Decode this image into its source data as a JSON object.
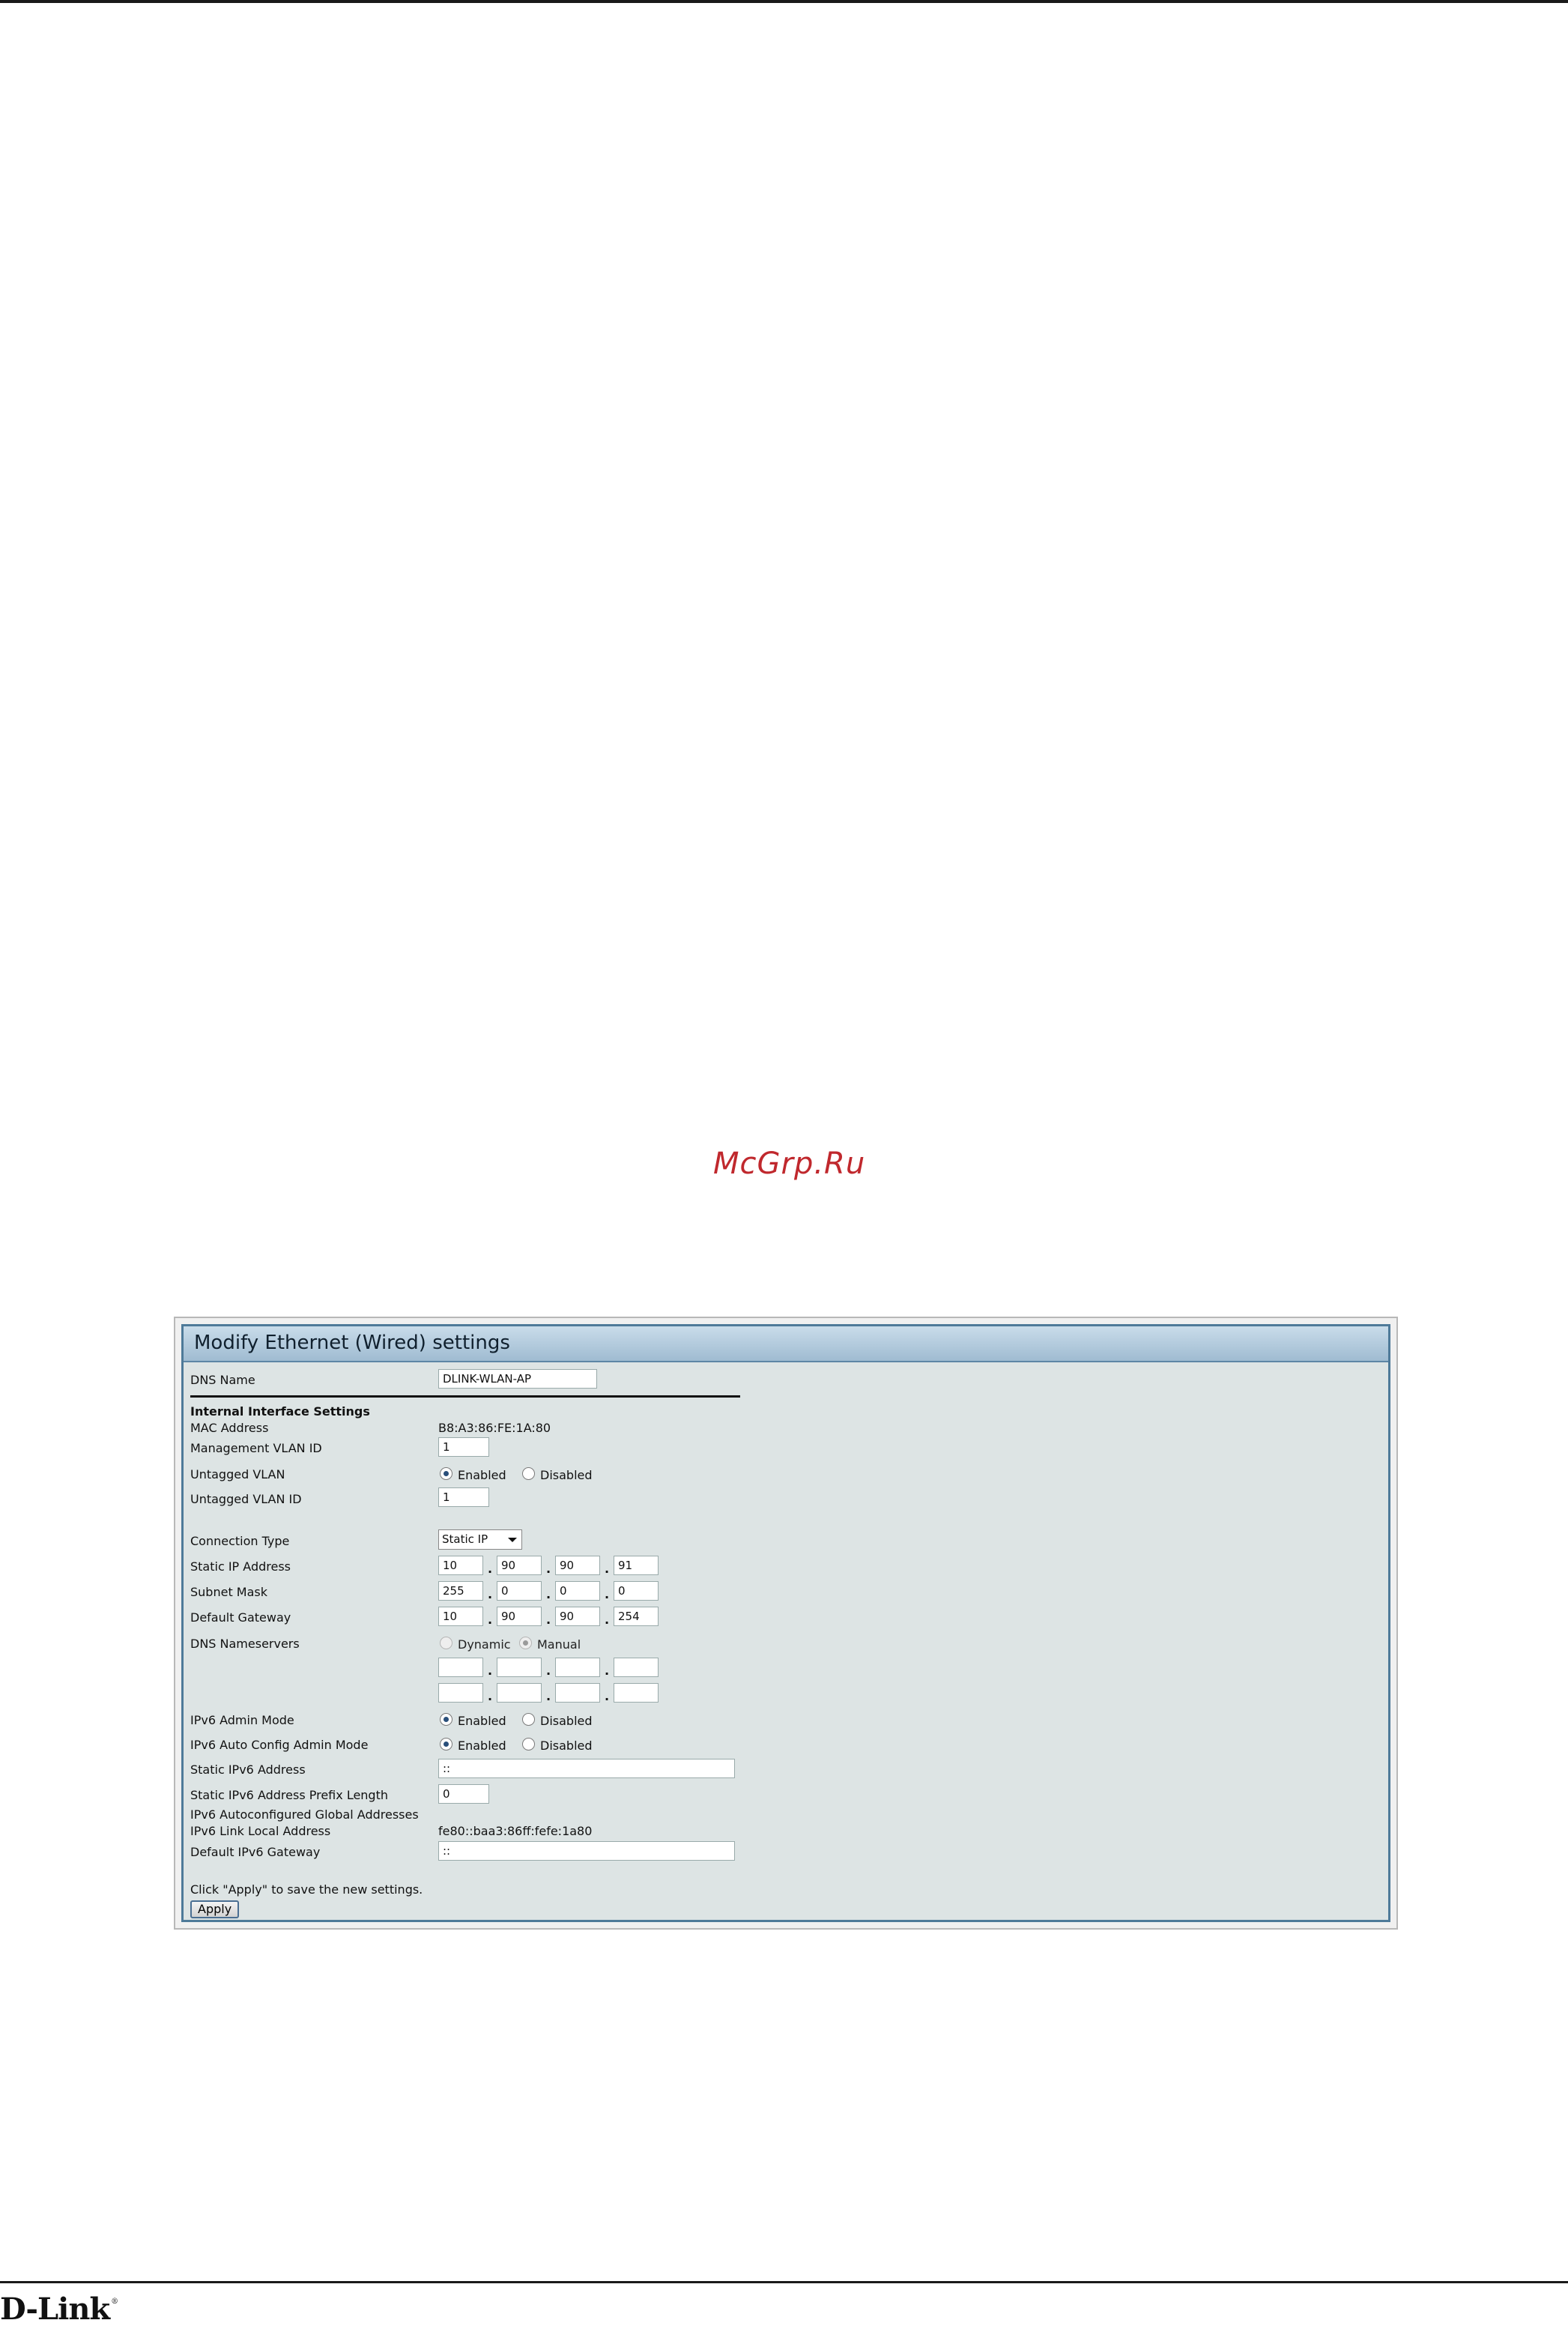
{
  "watermark": "McGrp.Ru",
  "logo": {
    "text": "D-Link",
    "mark": "®"
  },
  "panel": {
    "title": "Modify Ethernet (Wired) settings",
    "dns_name": {
      "label": "DNS Name",
      "value": "DLINK-WLAN-AP"
    },
    "section_title": "Internal Interface Settings",
    "mac": {
      "label": "MAC Address",
      "value": "B8:A3:86:FE:1A:80"
    },
    "mgmt_vlan": {
      "label": "Management VLAN ID",
      "value": "1"
    },
    "untagged_vlan": {
      "label": "Untagged VLAN",
      "enabled_label": "Enabled",
      "disabled_label": "Disabled",
      "selected": "Enabled"
    },
    "untagged_vlan_id": {
      "label": "Untagged VLAN ID",
      "value": "1"
    },
    "connection_type": {
      "label": "Connection Type",
      "value": "Static IP"
    },
    "static_ip": {
      "label": "Static IP Address",
      "octets": [
        "10",
        "90",
        "90",
        "91"
      ]
    },
    "subnet": {
      "label": "Subnet Mask",
      "octets": [
        "255",
        "0",
        "0",
        "0"
      ]
    },
    "gateway": {
      "label": "Default Gateway",
      "octets": [
        "10",
        "90",
        "90",
        "254"
      ]
    },
    "dns_servers": {
      "label": "DNS Nameservers",
      "dynamic_label": "Dynamic",
      "manual_label": "Manual",
      "selected": "Manual",
      "server1": [
        "",
        "",
        "",
        ""
      ],
      "server2": [
        "",
        "",
        "",
        ""
      ]
    },
    "ipv6_admin": {
      "label": "IPv6 Admin Mode",
      "enabled_label": "Enabled",
      "disabled_label": "Disabled",
      "selected": "Enabled"
    },
    "ipv6_auto": {
      "label": "IPv6 Auto Config Admin Mode",
      "enabled_label": "Enabled",
      "disabled_label": "Disabled",
      "selected": "Enabled"
    },
    "static_ipv6": {
      "label": "Static IPv6 Address",
      "value": "::"
    },
    "static_ipv6_prefix": {
      "label": "Static IPv6 Address Prefix Length",
      "value": "0"
    },
    "ipv6_autoconf_global": {
      "label": "IPv6 Autoconfigured Global Addresses"
    },
    "ipv6_link_local": {
      "label": "IPv6 Link Local Address",
      "value": "fe80::baa3:86ff:fefe:1a80"
    },
    "default_ipv6_gw": {
      "label": "Default IPv6 Gateway",
      "value": "::"
    },
    "hint": "Click \"Apply\" to save the new settings.",
    "apply_label": "Apply"
  }
}
